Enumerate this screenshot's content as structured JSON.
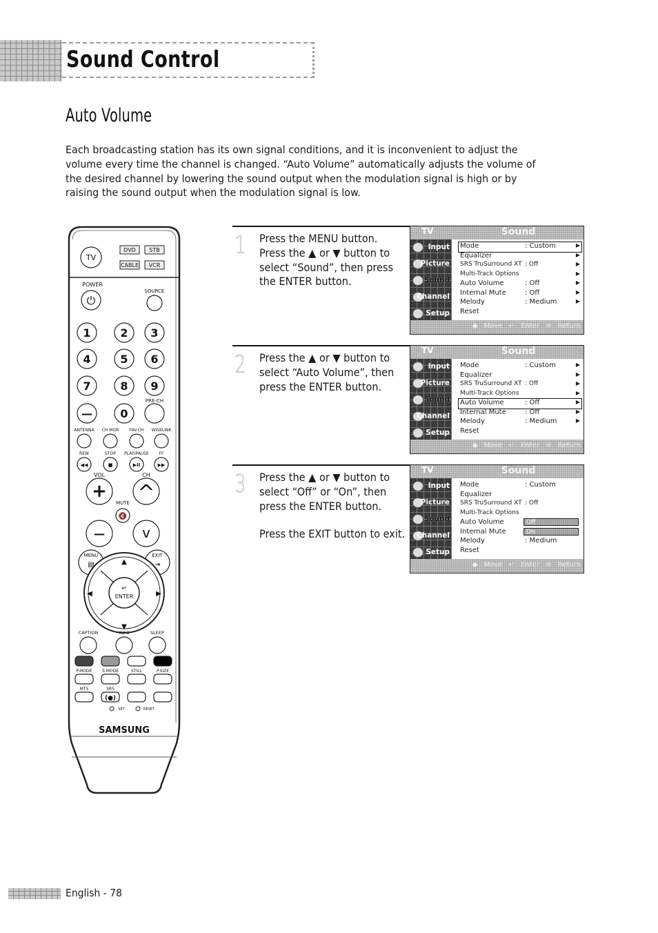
{
  "header": {
    "title": "Sound Control"
  },
  "section": {
    "title": "Auto Volume",
    "intro": "Each broadcasting station has its own signal conditions, and it is inconvenient to adjust the volume every time the channel is changed. “Auto Volume” automatically adjusts the volume of the desired channel by lowering the sound output when the modulation signal is high or by raising the sound output when the modulation signal is low."
  },
  "remote": {
    "brand": "SAMSUNG",
    "tv": "TV",
    "modes": [
      "DVD",
      "STB",
      "CABLE",
      "VCR"
    ],
    "power": "POWER",
    "source": "SOURCE",
    "digits": [
      "1",
      "2",
      "3",
      "4",
      "5",
      "6",
      "7",
      "8",
      "9",
      "—",
      "0"
    ],
    "prech": "PRE-CH",
    "row_labels": [
      "ANTENNA",
      "CH MGR",
      "FAV.CH",
      "WISELINK"
    ],
    "transport_labels": [
      "REW",
      "STOP",
      "PLAY/PAUSE",
      "FF"
    ],
    "transport_icons": [
      "◀◀",
      "■",
      "▶II",
      "▶▶"
    ],
    "vol": "VOL",
    "ch": "CH",
    "mute": "MUTE",
    "menu": "MENU",
    "exit": "EXIT",
    "enter": "ENTER",
    "func_labels": [
      "CAPTION",
      "INFO",
      "SLEEP"
    ],
    "color_labels": [
      "P.MODE",
      "S.MODE",
      "STILL",
      "P.SIZE"
    ],
    "mts": "MTS",
    "srs": "SRS",
    "srs_icon": "(●)",
    "set": "SET",
    "reset": "RESET"
  },
  "steps": [
    {
      "number": "1",
      "paragraphs": [
        "Press the MENU button. Press the ▲ or ▼ button to select “Sound”, then press the ENTER button."
      ]
    },
    {
      "number": "2",
      "paragraphs": [
        "Press the ▲ or ▼ button to select “Auto Volume”, then press the ENTER button."
      ]
    },
    {
      "number": "3",
      "paragraphs": [
        "Press the ▲ or ▼ button to select “Off” or “On”, then press the ENTER button.",
        "Press the EXIT button to exit."
      ]
    }
  ],
  "osd": {
    "tv_label": "TV",
    "title": "Sound",
    "sidebar": [
      "Input",
      "Picture",
      "Sound",
      "Channel",
      "Setup"
    ],
    "active_sidebar": "Sound",
    "help": {
      "move": "◆ Move",
      "enter": "↵ Enter",
      "return": "≡ Return"
    },
    "menu": [
      {
        "label": "Mode",
        "value": ": Custom",
        "arrow": "▶"
      },
      {
        "label": "Equalizer",
        "value": "",
        "arrow": "▶"
      },
      {
        "label": "SRS TruSurround XT",
        "value": ": Off",
        "arrow": "▶"
      },
      {
        "label": "Multi-Track Options",
        "value": "",
        "arrow": "▶"
      },
      {
        "label": "Auto Volume",
        "value": ": Off",
        "arrow": "▶"
      },
      {
        "label": "Internal Mute",
        "value": ": Off",
        "arrow": "▶"
      },
      {
        "label": "Melody",
        "value": ": Medium",
        "arrow": "▶"
      },
      {
        "label": "Reset",
        "value": "",
        "arrow": ""
      }
    ],
    "screens": [
      {
        "selected_index": 0
      },
      {
        "selected_index": 4
      },
      {
        "selected_index": 4,
        "popup_options": [
          "Off",
          "On"
        ],
        "popup_selected": "Off"
      }
    ]
  },
  "footer": {
    "page": "English - 78"
  }
}
